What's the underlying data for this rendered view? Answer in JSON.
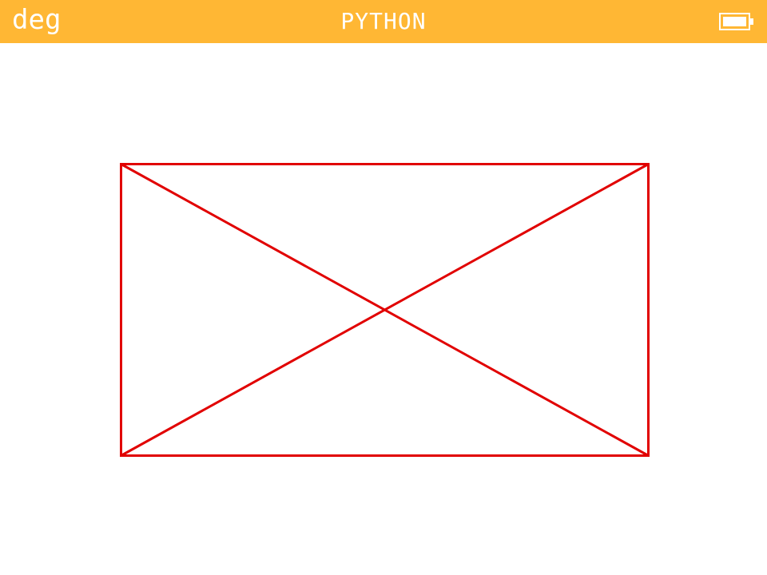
{
  "status_bar": {
    "angle_mode": "deg",
    "app_title": "PYTHON",
    "battery_icon": "battery-full-icon",
    "background_color": "#ffb734",
    "text_color": "#ffffff"
  },
  "drawing": {
    "shapes": [
      "rectangle",
      "diagonal",
      "diagonal"
    ],
    "stroke_color": "#e10000"
  }
}
